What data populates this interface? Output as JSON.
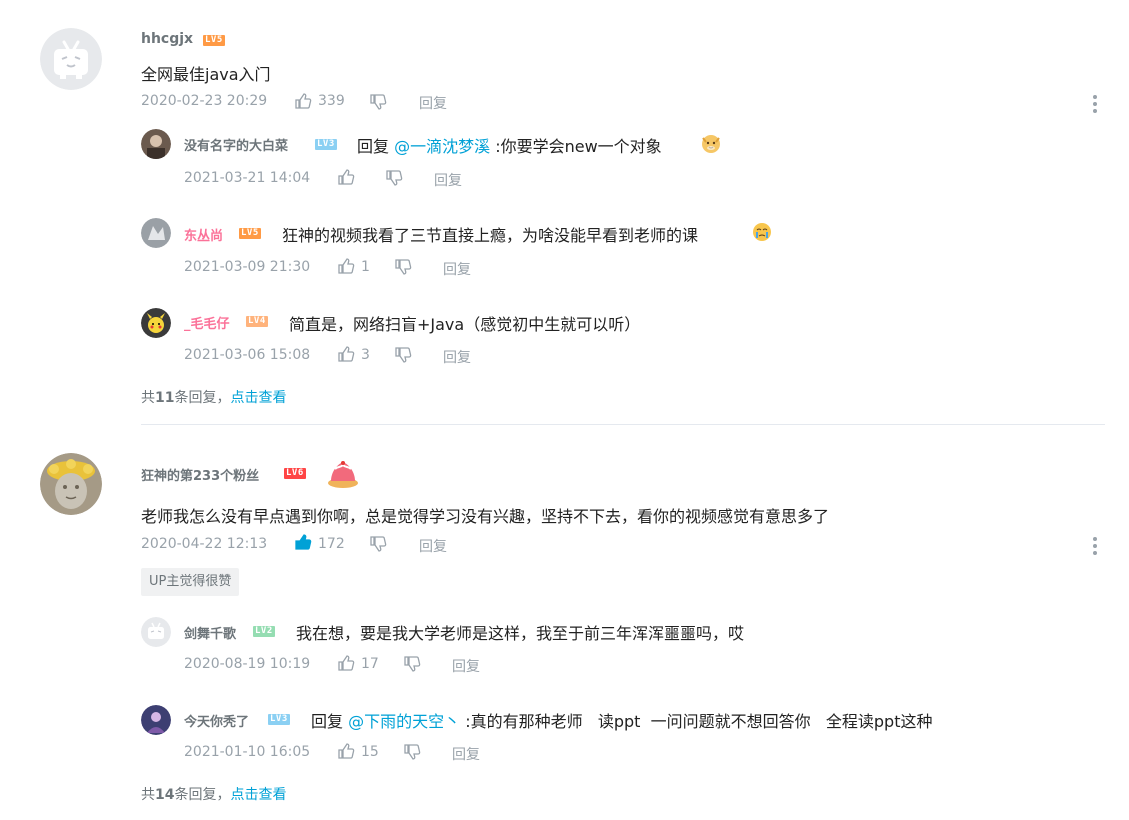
{
  "comments": [
    {
      "user": "hhcgjx",
      "level": "LV5",
      "text": "全网最佳java入门",
      "time": "2020-02-23 20:29",
      "likes": "339",
      "reply_label": "回复",
      "replies": [
        {
          "user": "没有名字的大白菜",
          "level": "LV3",
          "prefix": "回复",
          "mention": "@一滴沈梦溪",
          "text": " :你要学会new一个对象",
          "time": "2021-03-21 14:04",
          "likes": "",
          "reply_label": "回复"
        },
        {
          "user": "东丛尚",
          "level": "LV5",
          "text": "狂神的视频我看了三节直接上瘾，为啥没能早看到老师的课",
          "time": "2021-03-09 21:30",
          "likes": "1",
          "reply_label": "回复"
        },
        {
          "user": "_毛毛仔",
          "level": "LV4",
          "text": "简直是，网络扫盲+Java（感觉初中生就可以听）",
          "time": "2021-03-06 15:08",
          "likes": "3",
          "reply_label": "回复"
        }
      ],
      "summary_prefix": "共",
      "summary_count": "11",
      "summary_suffix": "条回复，",
      "summary_link": "点击查看"
    },
    {
      "user": "狂神的第233个粉丝",
      "level": "LV6",
      "text": "老师我怎么没有早点遇到你啊，总是觉得学习没有兴趣，坚持不下去，看你的视频感觉有意思多了",
      "time": "2020-04-22 12:13",
      "likes": "172",
      "reply_label": "回复",
      "badge": "UP主觉得很赞",
      "replies": [
        {
          "user": "剑舞千歌",
          "level": "LV2",
          "text": "我在想，要是我大学老师是这样，我至于前三年浑浑噩噩吗，哎",
          "time": "2020-08-19 10:19",
          "likes": "17",
          "reply_label": "回复"
        },
        {
          "user": "今天你秃了",
          "level": "LV3",
          "prefix": "回复",
          "mention": "@下雨的天空丶",
          "text": " :真的有那种老师   读ppt  一问问题就不想回答你   全程读ppt这种",
          "time": "2021-01-10 16:05",
          "likes": "15",
          "reply_label": "回复"
        }
      ],
      "summary_prefix": "共",
      "summary_count": "14",
      "summary_suffix": "条回复，",
      "summary_link": "点击查看"
    }
  ],
  "colors": {
    "link": "#00a1d6",
    "meta": "#99a2aa",
    "pink_name": "#fb7299",
    "liked": "#00a1d6"
  },
  "icons": [
    "bilibili-tv-avatar-icon",
    "thumb-up-icon",
    "thumb-down-icon",
    "more-vertical-icon",
    "emoji-icon"
  ]
}
